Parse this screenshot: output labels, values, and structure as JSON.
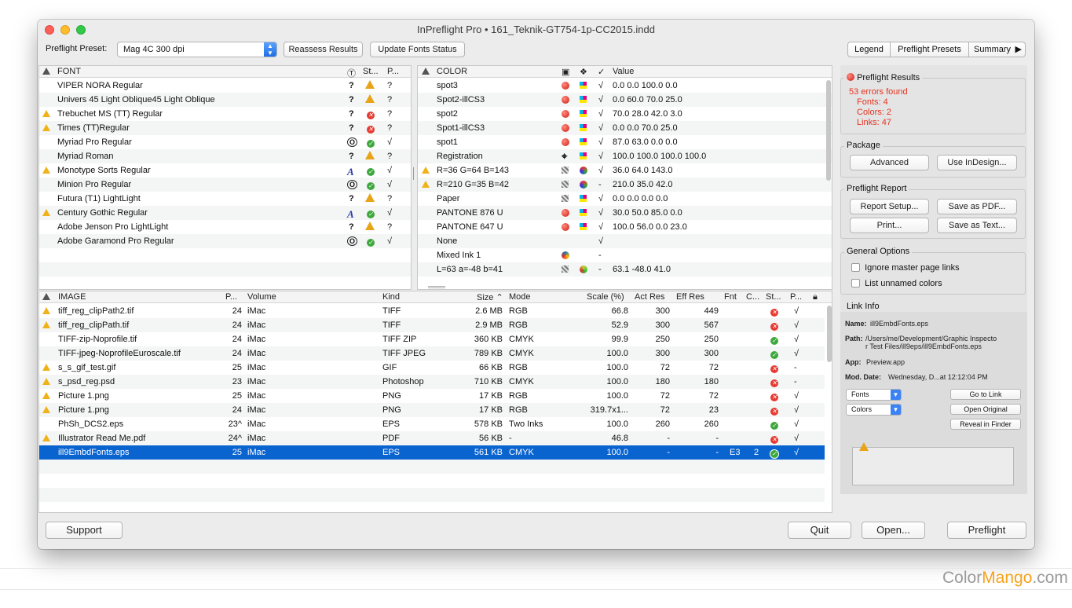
{
  "window": {
    "title": "InPreflight Pro • 161_Teknik-GT754-1p-CC2015.indd"
  },
  "toolbar": {
    "preset_label": "Preflight Preset:",
    "preset_value": "Mag 4C 300 dpi",
    "reassess": "Reassess Results",
    "update_fonts": "Update Fonts Status",
    "legend": "Legend",
    "presets": "Preflight Presets",
    "summary": "Summary"
  },
  "font_table": {
    "headers": {
      "name": "FONT",
      "status": "St...",
      "p": "P..."
    },
    "rows": [
      {
        "warn": false,
        "name": "VIPER NORA     Regular",
        "type": "?",
        "status": "warn",
        "p": "?"
      },
      {
        "warn": false,
        "name": "Univers     45 Light Oblique45 Light Oblique",
        "type": "?",
        "status": "warn",
        "p": "?"
      },
      {
        "warn": true,
        "name": "Trebuchet MS (TT)        Regular",
        "type": "?",
        "status": "error",
        "p": "?"
      },
      {
        "warn": true,
        "name": "Times (TT)Regular",
        "type": "?",
        "status": "error",
        "p": "?"
      },
      {
        "warn": false,
        "name": "Myriad Pro Regular",
        "type": "O",
        "status": "ok",
        "p": "√"
      },
      {
        "warn": false,
        "name": "Myriad        Roman",
        "type": "?",
        "status": "warn",
        "p": "?"
      },
      {
        "warn": true,
        "name": "Monotype Sorts Regular",
        "type": "A",
        "status": "ok",
        "p": "√"
      },
      {
        "warn": false,
        "name": "Minion Pro Regular",
        "type": "O",
        "status": "ok",
        "p": "√"
      },
      {
        "warn": false,
        "name": "Futura (T1)        LightLight",
        "type": "?",
        "status": "warn",
        "p": "?"
      },
      {
        "warn": true,
        "name": "Century Gothic Regular",
        "type": "A",
        "status": "ok",
        "p": "√"
      },
      {
        "warn": false,
        "name": "Adobe Jenson Pro      LightLight",
        "type": "?",
        "status": "warn",
        "p": "?"
      },
      {
        "warn": false,
        "name": "Adobe Garamond Pro Regular",
        "type": "O",
        "status": "ok",
        "p": "√"
      }
    ]
  },
  "color_table": {
    "headers": {
      "name": "COLOR",
      "check": "✓",
      "value": "Value"
    },
    "rows": [
      {
        "warn": false,
        "name": "spot3",
        "i1": "ball",
        "i2": "cmyk",
        "ck": "√",
        "value": "0.0  0.0  100.0  0.0"
      },
      {
        "warn": false,
        "name": "Spot2-illCS3",
        "i1": "ball",
        "i2": "cmyk",
        "ck": "√",
        "value": "0.0  60.0  70.0  25.0"
      },
      {
        "warn": false,
        "name": "spot2",
        "i1": "ball",
        "i2": "cmyk",
        "ck": "√",
        "value": "70.0  28.0  42.0  3.0"
      },
      {
        "warn": false,
        "name": "Spot1-illCS3",
        "i1": "ball",
        "i2": "cmyk",
        "ck": "√",
        "value": "0.0  0.0  70.0  25.0"
      },
      {
        "warn": false,
        "name": "spot1",
        "i1": "ball",
        "i2": "cmyk",
        "ck": "√",
        "value": "87.0  63.0  0.0  0.0"
      },
      {
        "warn": false,
        "name": "Registration",
        "i1": "target",
        "i2": "cmyk",
        "ck": "√",
        "value": "100.0  100.0  100.0  100.0"
      },
      {
        "warn": true,
        "name": "R=36 G=64 B=143",
        "i1": "mix",
        "i2": "rgb",
        "ck": "√",
        "value": "36.0  64.0  143.0"
      },
      {
        "warn": true,
        "name": "R=210 G=35 B=42",
        "i1": "mix",
        "i2": "rgb",
        "ck": "-",
        "value": "210.0  35.0  42.0"
      },
      {
        "warn": false,
        "name": "Paper",
        "i1": "mix",
        "i2": "cmyk",
        "ck": "√",
        "value": "0.0  0.0  0.0  0.0"
      },
      {
        "warn": false,
        "name": "PANTONE 876 U",
        "i1": "ball",
        "i2": "cmyk",
        "ck": "√",
        "value": "30.0  50.0  85.0  0.0"
      },
      {
        "warn": false,
        "name": "PANTONE 647 U",
        "i1": "ball",
        "i2": "cmyk",
        "ck": "√",
        "value": "100.0  56.0  0.0  23.0"
      },
      {
        "warn": false,
        "name": "None",
        "i1": "",
        "i2": "",
        "ck": "√",
        "value": ""
      },
      {
        "warn": false,
        "name": "Mixed Ink 1",
        "i1": "ink",
        "i2": "",
        "ck": "-",
        "value": ""
      },
      {
        "warn": false,
        "name": "L=63 a=-48 b=41",
        "i1": "mix",
        "i2": "lab",
        "ck": "-",
        "value": "63.1  -48.0  41.0"
      }
    ]
  },
  "image_table": {
    "headers": {
      "name": "IMAGE",
      "page": "P...",
      "volume": "Volume",
      "kind": "Kind",
      "size": "Size ⌃",
      "mode": "Mode",
      "scale": "Scale (%)",
      "actres": "Act Res",
      "effres": "Eff Res",
      "fnt": "Fnt",
      "c": "C...",
      "st": "St...",
      "p": "P..."
    },
    "rows": [
      {
        "warn": true,
        "name": "tiff_reg_clipPath2.tif",
        "page": "24",
        "volume": "iMac",
        "kind": "TIFF",
        "size": "2.6 MB",
        "mode": "RGB",
        "scale": "66.8",
        "actres": "300",
        "effres": "449",
        "fnt": "",
        "c": "",
        "st": "error",
        "p": "√"
      },
      {
        "warn": true,
        "name": "tiff_reg_clipPath.tif",
        "page": "24",
        "volume": "iMac",
        "kind": "TIFF",
        "size": "2.9 MB",
        "mode": "RGB",
        "scale": "52.9",
        "actres": "300",
        "effres": "567",
        "fnt": "",
        "c": "",
        "st": "error",
        "p": "√"
      },
      {
        "warn": false,
        "name": "TIFF-zip-Noprofile.tif",
        "page": "24",
        "volume": "iMac",
        "kind": "TIFF ZIP",
        "size": "360 KB",
        "mode": "CMYK",
        "scale": "99.9",
        "actres": "250",
        "effres": "250",
        "fnt": "",
        "c": "",
        "st": "ok",
        "p": "√"
      },
      {
        "warn": false,
        "name": "TIFF-jpeg-NoprofileEuroscale.tif",
        "page": "24",
        "volume": "iMac",
        "kind": "TIFF JPEG",
        "size": "789 KB",
        "mode": "CMYK",
        "scale": "100.0",
        "actres": "300",
        "effres": "300",
        "fnt": "",
        "c": "",
        "st": "ok",
        "p": "√"
      },
      {
        "warn": true,
        "name": "s_s_gif_test.gif",
        "page": "25",
        "volume": "iMac",
        "kind": "GIF",
        "size": "66 KB",
        "mode": "RGB",
        "scale": "100.0",
        "actres": "72",
        "effres": "72",
        "fnt": "",
        "c": "",
        "st": "error",
        "p": "-"
      },
      {
        "warn": true,
        "name": "s_psd_reg.psd",
        "page": "23",
        "volume": "iMac",
        "kind": "Photoshop",
        "size": "710 KB",
        "mode": "CMYK",
        "scale": "100.0",
        "actres": "180",
        "effres": "180",
        "fnt": "",
        "c": "",
        "st": "error",
        "p": "-"
      },
      {
        "warn": true,
        "name": "Picture 1.png",
        "page": "25",
        "volume": "iMac",
        "kind": "PNG",
        "size": "17 KB",
        "mode": "RGB",
        "scale": "100.0",
        "actres": "72",
        "effres": "72",
        "fnt": "",
        "c": "",
        "st": "error",
        "p": "√"
      },
      {
        "warn": true,
        "name": "Picture 1.png",
        "page": "24",
        "volume": "iMac",
        "kind": "PNG",
        "size": "17 KB",
        "mode": "RGB",
        "scale": "319.7x1...",
        "actres": "72",
        "effres": "23",
        "fnt": "",
        "c": "",
        "st": "error",
        "p": "√"
      },
      {
        "warn": false,
        "name": "PhSh_DCS2.eps",
        "page": "23^",
        "volume": "iMac",
        "kind": "EPS",
        "size": "578 KB",
        "mode": "Two Inks",
        "scale": "100.0",
        "actres": "260",
        "effres": "260",
        "fnt": "",
        "c": "",
        "st": "ok",
        "p": "√"
      },
      {
        "warn": true,
        "name": "Illustrator Read Me.pdf",
        "page": "24^",
        "volume": "iMac",
        "kind": "PDF",
        "size": "56 KB",
        "mode": "-",
        "scale": "46.8",
        "actres": "-",
        "effres": "-",
        "fnt": "",
        "c": "",
        "st": "error",
        "p": "√"
      },
      {
        "warn": false,
        "sel": true,
        "name": "ill9EmbdFonts.eps",
        "page": "25",
        "volume": "iMac",
        "kind": "EPS",
        "size": "561 KB",
        "mode": "CMYK",
        "scale": "100.0",
        "actres": "-",
        "effres": "-",
        "fnt": "E3",
        "c": "2",
        "st": "ok",
        "p": "√"
      }
    ]
  },
  "results": {
    "title": "Preflight Results",
    "errors": "53 errors found",
    "fonts": "Fonts: 4",
    "colors": "Colors: 2",
    "links": "Links: 47"
  },
  "package": {
    "title": "Package",
    "advanced": "Advanced",
    "use_indesign": "Use InDesign..."
  },
  "report": {
    "title": "Preflight Report",
    "setup": "Report Setup...",
    "save_pdf": "Save as PDF...",
    "print": "Print...",
    "save_text": "Save as Text..."
  },
  "options": {
    "title": "General Options",
    "ignore": "Ignore master page links",
    "list": "List unnamed colors"
  },
  "link_info": {
    "title": "Link Info",
    "name_label": "Name:",
    "name": "ill9EmbdFonts.eps",
    "path_label": "Path:",
    "path1": "/Users/me/Development/Graphic Inspecto",
    "path2": "r Test Files/ill9eps/ill9EmbdFonts.eps",
    "app_label": "App:",
    "app": "Preview.app",
    "mod_label": "Mod. Date:",
    "mod": "Wednesday, D...at 12:12:04 PM",
    "fonts_sel": "Fonts",
    "colors_sel": "Colors",
    "go_link": "Go to Link",
    "open_original": "Open Original",
    "reveal": "Reveal in Finder"
  },
  "bottom": {
    "support": "Support",
    "quit": "Quit",
    "open": "Open...",
    "preflight": "Preflight"
  },
  "watermark": {
    "text1": "Color",
    "text2": "Mango",
    "text3": ".com"
  }
}
